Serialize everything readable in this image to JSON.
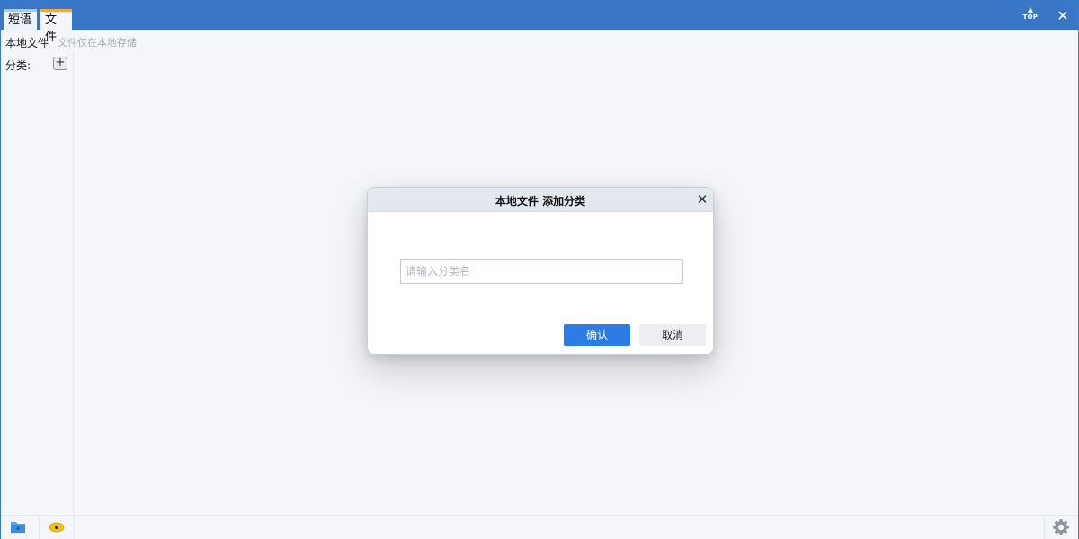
{
  "tabs": [
    {
      "label": "短语"
    },
    {
      "label": "文件"
    }
  ],
  "titlebar": {
    "top_label": "TOP",
    "top_icon": "pin-top-icon",
    "close_icon": "close-icon"
  },
  "header": {
    "title": "本地文件",
    "hint": "文件仅在本地存储"
  },
  "sidebar": {
    "category_label": "分类:",
    "add_icon": "plus-box-icon"
  },
  "dialog": {
    "title": "本地文件 添加分类",
    "input_placeholder": "请输入分类名",
    "input_value": "",
    "confirm_label": "确认",
    "cancel_label": "取消"
  },
  "footer": {
    "icons": [
      "folder-icon",
      "eye-icon",
      "gear-icon"
    ]
  },
  "colors": {
    "titlebar": "#3a76c6",
    "tab_active_accent": "#9bd0f5",
    "tab_file_accent": "#f2a93b",
    "primary_button": "#2d7be5",
    "background": "#f4f6fa"
  }
}
